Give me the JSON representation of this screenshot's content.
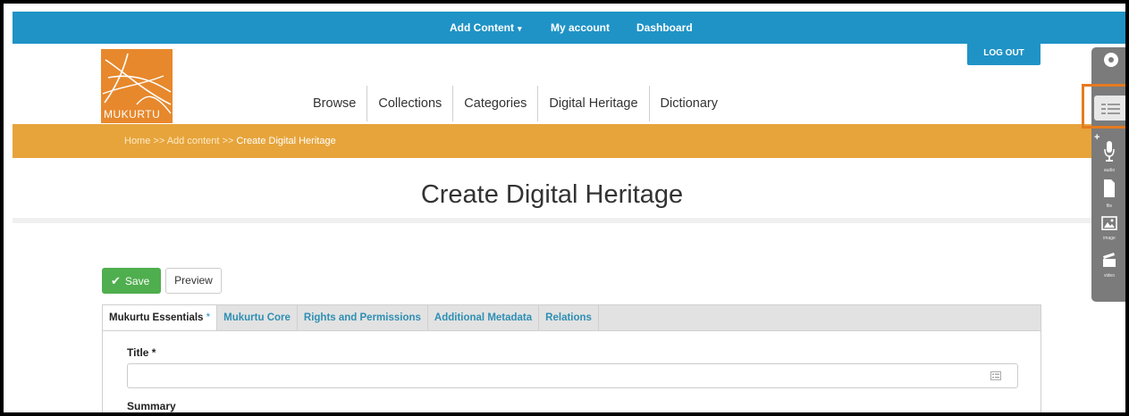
{
  "admin_bar": {
    "add_content": "Add Content",
    "caret": "▾",
    "my_account": "My account",
    "dashboard": "Dashboard"
  },
  "logout": "LOG OUT",
  "logo": {
    "text": "MUKURTU"
  },
  "main_nav": [
    "Browse",
    "Collections",
    "Categories",
    "Digital Heritage",
    "Dictionary"
  ],
  "breadcrumb": {
    "home": "Home",
    "sep": ">>",
    "add_content": "Add content",
    "current": "Create Digital Heritage"
  },
  "page_title": "Create Digital Heritage",
  "buttons": {
    "save": "Save",
    "preview": "Preview"
  },
  "tabs": [
    {
      "label": "Mukurtu Essentials",
      "required": "*"
    },
    {
      "label": "Mukurtu Core"
    },
    {
      "label": "Rights and Permissions"
    },
    {
      "label": "Additional Metadata"
    },
    {
      "label": "Relations"
    }
  ],
  "form": {
    "title_label": "Title *",
    "title_value": "",
    "summary_label": "Summary"
  },
  "media_toolbar": {
    "plus": "+",
    "audio": "audio",
    "file": "file",
    "image": "image",
    "video": "video"
  },
  "colors": {
    "admin_bar": "#1f93c6",
    "breadcrumb_bar": "#e7a43b",
    "logo": "#e7882c",
    "save": "#4fae4e",
    "highlight": "#e57a20"
  }
}
